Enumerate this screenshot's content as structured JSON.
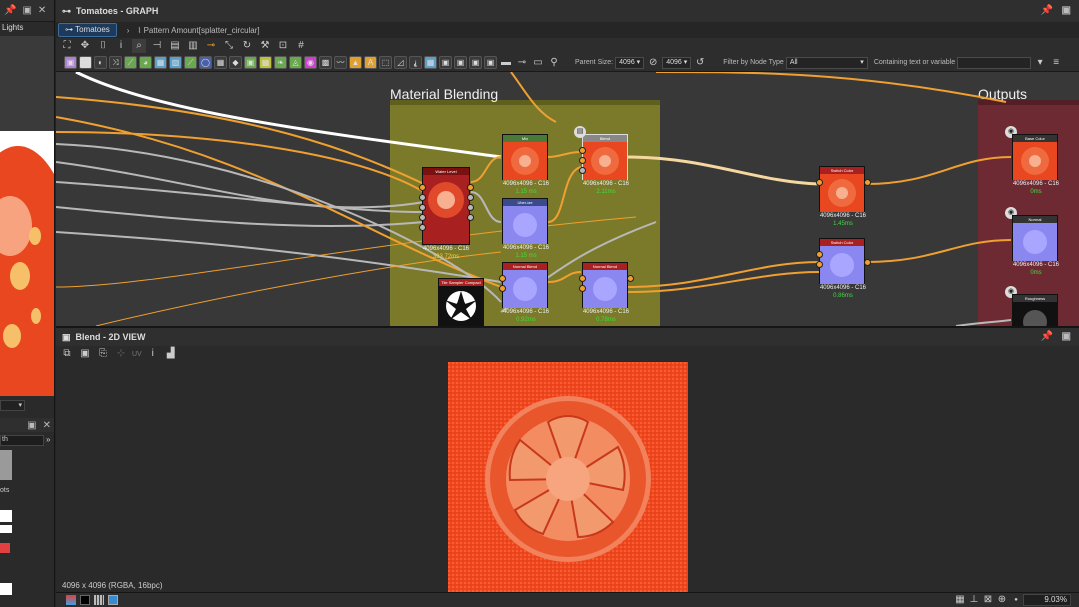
{
  "left_panel": {
    "top_label": "Lights",
    "mid_label_1": "th",
    "mid_label_2": "ots"
  },
  "graph": {
    "window_title": "Tomatoes - GRAPH",
    "tab_label": "Tomatoes",
    "breadcrumb": "Pattern Amount[splatter_circular]",
    "parent_size_label": "Parent Size:",
    "parent_size_value": "4096",
    "size_value": "4096",
    "filter_label": "Filter by Node Type",
    "filter_value": "All",
    "contains_label": "Containing text or variable",
    "contains_value": ""
  },
  "frames": {
    "blending": "Material Blending",
    "outputs": "Outputs"
  },
  "nodes": {
    "water_level": {
      "title": "Water Level",
      "caption": "4096x4096 - C16",
      "time": "333.72ms",
      "time_color": "#f3d23a"
    },
    "mix": {
      "title": "Mix",
      "caption": "4096x4096 - C16",
      "time": "1.15 ms"
    },
    "blend": {
      "title": "Blend",
      "caption": "4096x4096 - C16",
      "time": "2.11ms"
    },
    "uberize": {
      "title": "Uber-ize",
      "caption": "4096x4096 - C16",
      "time": "1.15 ms"
    },
    "normal_blend_1": {
      "title": "Normal Blend",
      "caption": "4096x4096 - C16",
      "time": "0.92ms"
    },
    "normal_blend_2": {
      "title": "Normal Blend",
      "caption": "4096x4096 - C16",
      "time": "0.78ms"
    },
    "tile_sampler": {
      "title": "Tile Sampler Compact",
      "caption": "",
      "time": ""
    },
    "switch_color": {
      "title": "Switch Color",
      "caption": "4096x4096 - C16",
      "time": "1.45ms"
    },
    "switch_normal": {
      "title": "Switch Color",
      "caption": "4096x4096 - C16",
      "time": "0.86ms"
    },
    "out_basecolor": {
      "title": "Base Color",
      "caption": "4096x4096 - C16",
      "time": "0ms"
    },
    "out_normal": {
      "title": "Normal",
      "caption": "4096x4096 - C16",
      "time": "0ms"
    },
    "out_roughness": {
      "title": "Roughness",
      "caption": "",
      "time": ""
    }
  },
  "view": {
    "window_title": "Blend - 2D VIEW",
    "uv_label": "UV",
    "image_info": "4096 x 4096 (RGBA, 16bpc)"
  },
  "status": {
    "zoom": "9.03%"
  },
  "colors": {
    "frame": "#7b7a2a",
    "outputs_frame": "#6e2a33",
    "wire_orange": "#f0a030",
    "wire_gray": "#b8b8b8",
    "tomato": "#f0461e"
  }
}
